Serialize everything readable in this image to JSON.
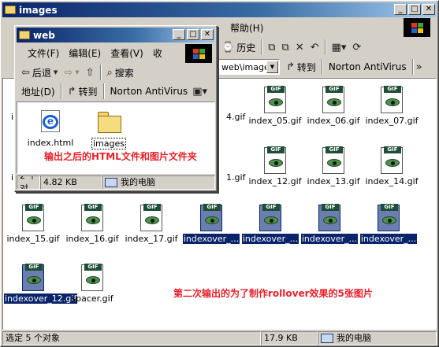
{
  "outer": {
    "title": "images",
    "menu_help": "帮助(H)",
    "toolbar_history": "历史",
    "address_value": "web\\images",
    "go_label": "转到",
    "norton_label": "Norton AntiVirus",
    "status_count": "选定 5 个对象",
    "status_size": "17.9 KB",
    "status_location": "我的电脑"
  },
  "inner": {
    "title": "web",
    "menu": [
      "文件(F)",
      "编辑(E)",
      "查看(V)",
      "收"
    ],
    "back_label": "后退",
    "search_label": "搜索",
    "address_label": "地址(D)",
    "go_label": "转到",
    "norton_label": "Norton AntiVirus",
    "files": [
      {
        "name": "index.html",
        "icon": "ie-icon"
      },
      {
        "name": "images",
        "icon": "folder-icon"
      }
    ],
    "annotation": "输出之后的HTML文件和图片文件夹",
    "status_count": "2 个对",
    "status_size": "4.82 KB",
    "status_location": "我的电脑"
  },
  "outer_files": [
    {
      "name": "index_05.gif",
      "selected": false
    },
    {
      "name": "index_06.gif",
      "selected": false
    },
    {
      "name": "index_07.gif",
      "selected": false
    },
    {
      "name": "index_12.gif",
      "selected": false
    },
    {
      "name": "index_13.gif",
      "selected": false
    },
    {
      "name": "index_14.gif",
      "selected": false
    },
    {
      "name": "index_15.gif",
      "selected": false
    },
    {
      "name": "index_16.gif",
      "selected": false
    },
    {
      "name": "index_17.gif",
      "selected": false
    },
    {
      "name": "indexover_...",
      "selected": true
    },
    {
      "name": "indexover_...",
      "selected": true
    },
    {
      "name": "indexover_...",
      "selected": true
    },
    {
      "name": "indexover_...",
      "selected": true
    },
    {
      "name": "indexover_12.gif",
      "selected": true
    },
    {
      "name": "spacer.gif",
      "selected": false
    }
  ],
  "partial_labels": [
    "i",
    "4.gif",
    "i",
    "1.gif"
  ],
  "gif_tag": "GIF",
  "annotation_bottom": "第二次输出的为了制作rollover效果的5张图片",
  "colors": {
    "annotation": "#e8212a",
    "selection": "#0a246a",
    "title_bar": "#0a246a"
  }
}
